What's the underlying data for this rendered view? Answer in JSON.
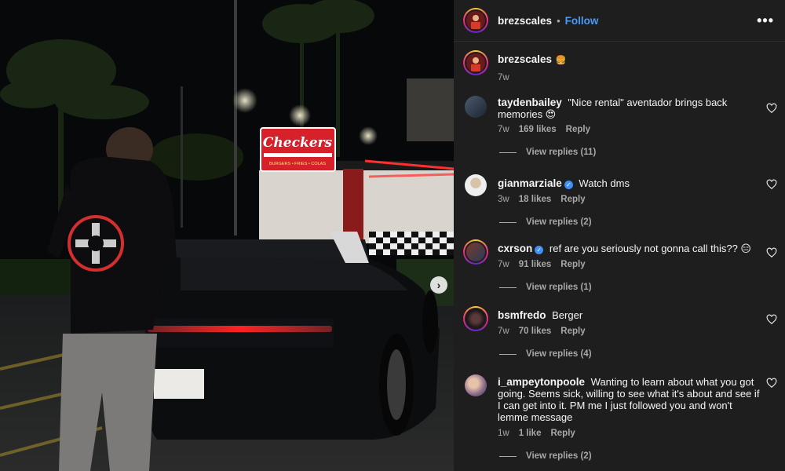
{
  "header": {
    "username": "brezscales",
    "separator": "•",
    "follow_label": "Follow",
    "more_label": "•••"
  },
  "caption": {
    "username": "brezscales",
    "emoji": "🍔",
    "time": "7w"
  },
  "photo": {
    "sign_text": "Checkers",
    "sign_subtext": "BURGERS • FRIES • COLAS",
    "next_label": "›"
  },
  "comments": [
    {
      "username": "taydenbailey",
      "verified": false,
      "text": "\"Nice rental\" aventador brings back memories 😍",
      "time": "7w",
      "likes": "169 likes",
      "reply_label": "Reply",
      "view_replies": "View replies (11)"
    },
    {
      "username": "gianmarziale",
      "verified": true,
      "text": "Watch dms",
      "time": "3w",
      "likes": "18 likes",
      "reply_label": "Reply",
      "view_replies": "View replies (2)"
    },
    {
      "username": "cxrson",
      "verified": true,
      "text": "ref are you seriously not gonna call this?? 😑",
      "time": "7w",
      "likes": "91 likes",
      "reply_label": "Reply",
      "view_replies": "View replies (1)"
    },
    {
      "username": "bsmfredo",
      "verified": false,
      "text": "Berger",
      "time": "7w",
      "likes": "70 likes",
      "reply_label": "Reply",
      "view_replies": "View replies (4)"
    },
    {
      "username": "i_ampeytonpoole",
      "verified": false,
      "text": "Wanting to learn about what you got going. Seems sick, willing to see what it's about and see if I can get into it. PM me I just followed you and won't lemme message",
      "time": "1w",
      "likes": "1 like",
      "reply_label": "Reply",
      "view_replies": "View replies (2)"
    }
  ],
  "icons": {
    "heart": "heart-outline-icon",
    "verified": "verified-badge-icon",
    "next": "chevron-right-icon",
    "more": "more-horizontal-icon"
  },
  "colors": {
    "panel_bg": "#1e1e1e",
    "link_blue": "#4a9bf5",
    "muted_text": "#a8a8a8",
    "verified_blue": "#3f8ff5",
    "sign_red": "#d6202a"
  }
}
